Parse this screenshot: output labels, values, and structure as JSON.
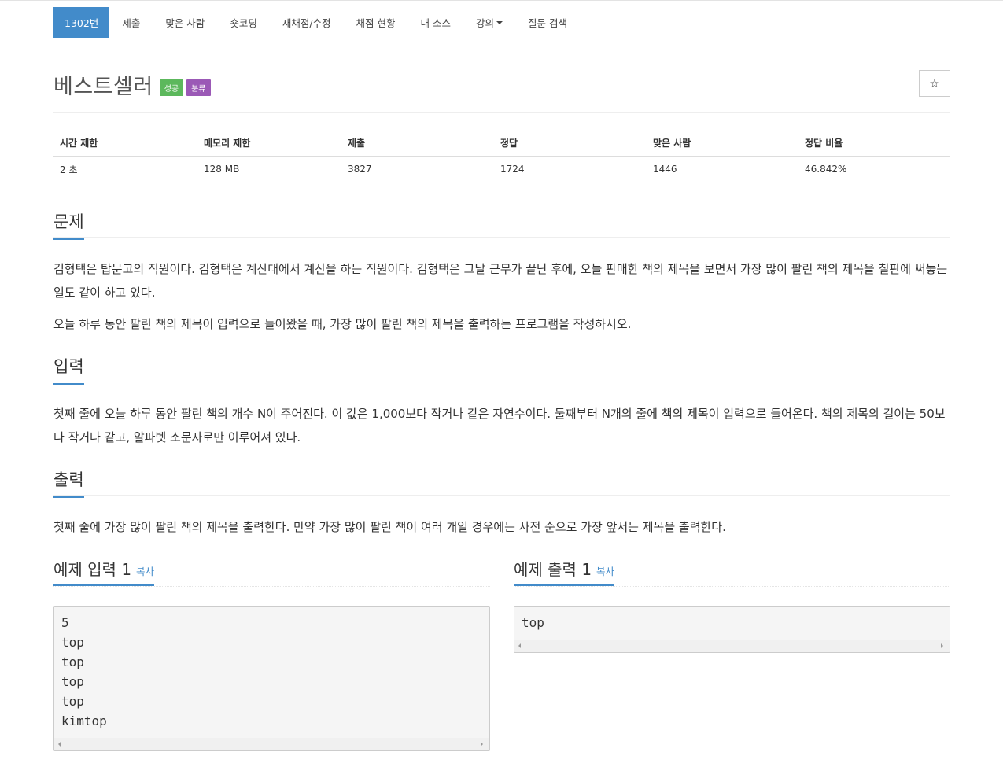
{
  "nav": {
    "items": [
      {
        "label": "1302번",
        "active": true
      },
      {
        "label": "제출"
      },
      {
        "label": "맞은 사람"
      },
      {
        "label": "숏코딩"
      },
      {
        "label": "재채점/수정"
      },
      {
        "label": "채점 현황"
      },
      {
        "label": "내 소스"
      },
      {
        "label": "강의",
        "dropdown": true
      },
      {
        "label": "질문 검색"
      }
    ]
  },
  "problem": {
    "title": "베스트셀러",
    "badges": {
      "success": "성공",
      "category": "분류"
    },
    "star_icon": "☆"
  },
  "info_table": {
    "headers": [
      "시간 제한",
      "메모리 제한",
      "제출",
      "정답",
      "맞은 사람",
      "정답 비율"
    ],
    "values": [
      "2 초",
      "128 MB",
      "3827",
      "1724",
      "1446",
      "46.842%"
    ]
  },
  "sections": {
    "description": {
      "heading": "문제",
      "paragraphs": [
        "김형택은 탑문고의 직원이다. 김형택은 계산대에서 계산을 하는 직원이다. 김형택은 그날 근무가 끝난 후에, 오늘 판매한 책의 제목을 보면서 가장 많이 팔린 책의 제목을 칠판에 써놓는 일도 같이 하고 있다.",
        "오늘 하루 동안 팔린 책의 제목이 입력으로 들어왔을 때, 가장 많이 팔린 책의 제목을 출력하는 프로그램을 작성하시오."
      ]
    },
    "input": {
      "heading": "입력",
      "text": "첫째 줄에 오늘 하루 동안 팔린 책의 개수 N이 주어진다. 이 값은 1,000보다 작거나 같은 자연수이다. 둘째부터 N개의 줄에 책의 제목이 입력으로 들어온다. 책의 제목의 길이는 50보다 작거나 같고, 알파벳 소문자로만 이루어져 있다."
    },
    "output": {
      "heading": "출력",
      "text": "첫째 줄에 가장 많이 팔린 책의 제목을 출력한다. 만약 가장 많이 팔린 책이 여러 개일 경우에는 사전 순으로 가장 앞서는 제목을 출력한다."
    }
  },
  "samples": {
    "input": {
      "heading": "예제 입력 1",
      "copy_label": "복사",
      "content": "5\ntop\ntop\ntop\ntop\nkimtop"
    },
    "output": {
      "heading": "예제 출력 1",
      "copy_label": "복사",
      "content": "top"
    }
  },
  "colors": {
    "primary": "#428bca",
    "success": "#5cb85c",
    "category": "#9b59b6"
  }
}
